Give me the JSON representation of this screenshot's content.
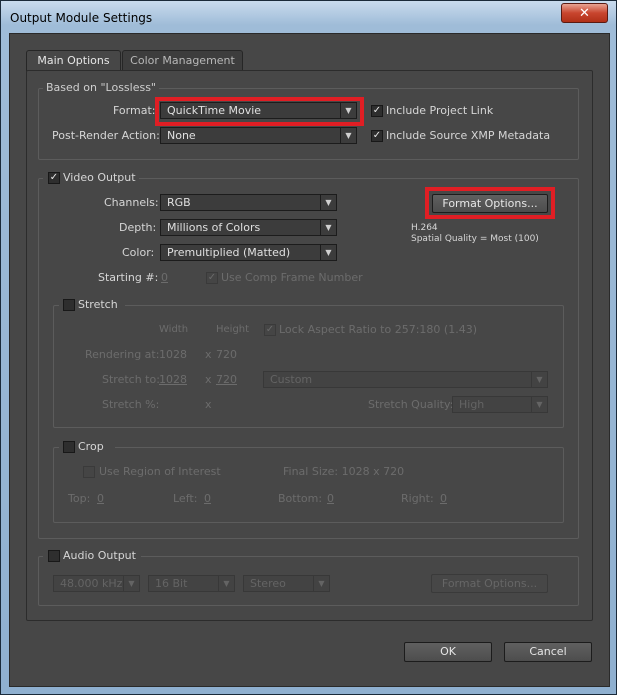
{
  "window": {
    "title": "Output Module Settings",
    "close_glyph": "✕"
  },
  "tabs": [
    {
      "label": "Main Options"
    },
    {
      "label": "Color Management"
    }
  ],
  "based_on": {
    "label": "Based on \"Lossless\"",
    "format_label": "Format:",
    "format_value": "QuickTime Movie",
    "post_render_label": "Post-Render Action:",
    "post_render_value": "None",
    "include_project_link": {
      "label": "Include Project Link",
      "checked": true
    },
    "include_xmp": {
      "label": "Include Source XMP Metadata",
      "checked": true
    }
  },
  "video": {
    "label": "Video Output",
    "checked": true,
    "channels_label": "Channels:",
    "channels_value": "RGB",
    "depth_label": "Depth:",
    "depth_value": "Millions of Colors",
    "color_label": "Color:",
    "color_value": "Premultiplied (Matted)",
    "starting_label": "Starting #:",
    "starting_value": "0",
    "use_comp_frame": "Use Comp Frame Number",
    "format_options_button": "Format Options...",
    "codec": "H.264",
    "spatial_quality": "Spatial Quality = Most (100)"
  },
  "stretch": {
    "label": "Stretch",
    "width_header": "Width",
    "height_header": "Height",
    "lock_aspect": "Lock Aspect Ratio to 257:180 (1.43)",
    "rendering_at_label": "Rendering at:",
    "rendering_w": "1028",
    "rendering_x": "x",
    "rendering_h": "720",
    "stretch_to_label": "Stretch to:",
    "stretch_w": "1028",
    "stretch_x": "x",
    "stretch_h": "720",
    "preset": "Custom",
    "stretch_pct_label": "Stretch %:",
    "stretch_pct_x": "x",
    "quality_label": "Stretch Quality:",
    "quality_value": "High"
  },
  "crop": {
    "label": "Crop",
    "use_roi": "Use Region of Interest",
    "final_size": "Final Size: 1028 x 720",
    "top_label": "Top:",
    "top": "0",
    "left_label": "Left:",
    "left": "0",
    "bottom_label": "Bottom:",
    "bottom": "0",
    "right_label": "Right:",
    "right": "0"
  },
  "audio": {
    "label": "Audio Output",
    "checked": false,
    "rate": "48.000 kHz",
    "bits": "16 Bit",
    "channels": "Stereo",
    "format_options_button": "Format Options..."
  },
  "footer": {
    "ok": "OK",
    "cancel": "Cancel"
  },
  "colors": {
    "highlight": "#e01e24",
    "panel": "#474747"
  },
  "glyphs": {
    "check": "✓",
    "arrow": "▼"
  }
}
